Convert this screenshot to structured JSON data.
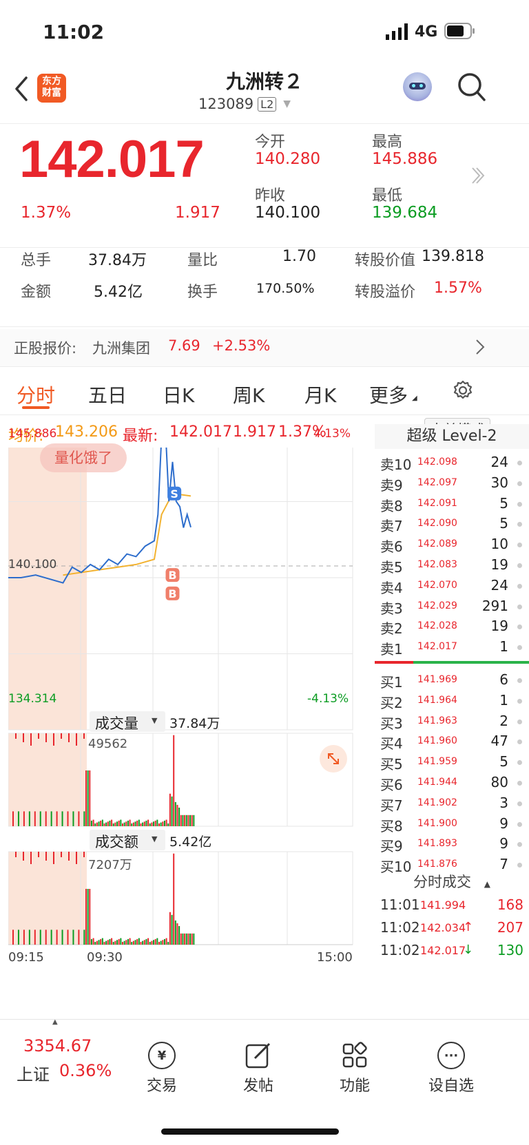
{
  "status": {
    "time": "11:02",
    "network": "4G"
  },
  "header": {
    "title": "九洲转２",
    "code": "123089",
    "level": "L2",
    "logo": "东方\n财富"
  },
  "quote": {
    "price": "142.017",
    "change_pct": "1.37%",
    "change": "1.917",
    "open_label": "今开",
    "open": "140.280",
    "high_label": "最高",
    "high": "145.886",
    "prev_label": "昨收",
    "prev": "140.100",
    "low_label": "最低",
    "low": "139.684"
  },
  "stats": {
    "vol_label": "总手",
    "vol": "37.84万",
    "ratio_label": "量比",
    "ratio": "1.70",
    "conv_label": "转股价值",
    "conv": "139.818",
    "amt_label": "金额",
    "amt": "5.42亿",
    "turn_label": "换手",
    "turn": "170.50%",
    "prem_label": "转股溢价",
    "prem": "1.57%"
  },
  "stock": {
    "label": "正股报价:",
    "name": "九洲集团",
    "price": "7.69",
    "change": "+2.53%"
  },
  "tabs": [
    "分时",
    "五日",
    "日K",
    "周K",
    "月K",
    "更多"
  ],
  "info": {
    "avg_label": "均价:",
    "avg": "143.206",
    "last_label": "最新:",
    "last": "142.017",
    "chg": "1.917",
    "pct": "1.37%",
    "mode_button": "大单模式"
  },
  "chart_data": {
    "type": "line",
    "title": "",
    "y_top": "145.886",
    "y_mid": "140.100",
    "y_bottom": "134.314",
    "pct_top": "4.13%",
    "pct_bottom": "-4.13%",
    "x_labels": [
      "09:15",
      "09:30",
      "15:00"
    ],
    "ylim": [
      134.314,
      145.886
    ],
    "series": [
      {
        "name": "价格",
        "x": [
          0,
          7,
          15,
          30,
          35,
          40,
          45,
          50,
          55,
          60,
          65,
          70,
          75,
          80,
          82,
          84,
          86,
          88,
          90,
          92,
          94,
          96,
          98,
          100
        ],
        "values": [
          140.1,
          140.1,
          140.2,
          139.9,
          140.5,
          140.3,
          140.6,
          140.4,
          140.8,
          140.6,
          141.0,
          140.9,
          141.3,
          141.5,
          142.5,
          145.5,
          145.9,
          143.0,
          144.5,
          143.0,
          142.8,
          142.0,
          142.5,
          142.017
        ]
      },
      {
        "name": "均价",
        "x": [
          30,
          40,
          50,
          60,
          70,
          80,
          84,
          90,
          100
        ],
        "values": [
          140.2,
          140.3,
          140.4,
          140.5,
          140.6,
          140.8,
          142.5,
          143.3,
          143.206
        ]
      }
    ],
    "watermark_badge": "量化饿了",
    "markers": [
      "S",
      "B",
      "B"
    ]
  },
  "volume": {
    "label": "成交量",
    "total": "37.84万",
    "max": "49562"
  },
  "amount": {
    "label": "成交额",
    "total": "5.42亿",
    "max": "7207万"
  },
  "orderbook": {
    "title": "超级 Level-2",
    "asks": [
      {
        "label": "卖10",
        "price": "142.098",
        "qty": "24"
      },
      {
        "label": "卖9",
        "price": "142.097",
        "qty": "30"
      },
      {
        "label": "卖8",
        "price": "142.091",
        "qty": "5"
      },
      {
        "label": "卖7",
        "price": "142.090",
        "qty": "5"
      },
      {
        "label": "卖6",
        "price": "142.089",
        "qty": "10"
      },
      {
        "label": "卖5",
        "price": "142.083",
        "qty": "19"
      },
      {
        "label": "卖4",
        "price": "142.070",
        "qty": "24"
      },
      {
        "label": "卖3",
        "price": "142.029",
        "qty": "291"
      },
      {
        "label": "卖2",
        "price": "142.028",
        "qty": "19"
      },
      {
        "label": "卖1",
        "price": "142.017",
        "qty": "1"
      }
    ],
    "bids": [
      {
        "label": "买1",
        "price": "141.969",
        "qty": "6"
      },
      {
        "label": "买2",
        "price": "141.964",
        "qty": "1"
      },
      {
        "label": "买3",
        "price": "141.963",
        "qty": "2"
      },
      {
        "label": "买4",
        "price": "141.960",
        "qty": "47"
      },
      {
        "label": "买5",
        "price": "141.959",
        "qty": "5"
      },
      {
        "label": "买6",
        "price": "141.944",
        "qty": "80"
      },
      {
        "label": "买7",
        "price": "141.902",
        "qty": "3"
      },
      {
        "label": "买8",
        "price": "141.900",
        "qty": "9"
      },
      {
        "label": "买9",
        "price": "141.893",
        "qty": "9"
      },
      {
        "label": "买10",
        "price": "141.876",
        "qty": "7"
      }
    ],
    "trades_title": "分时成交",
    "trades": [
      {
        "time": "11:01",
        "price": "141.994",
        "arrow": "",
        "qty": "168",
        "dir": "up"
      },
      {
        "time": "11:02",
        "price": "142.034",
        "arrow": "↑",
        "qty": "207",
        "dir": "up"
      },
      {
        "time": "11:02",
        "price": "142.017",
        "arrow": "↓",
        "qty": "130",
        "dir": "down"
      }
    ]
  },
  "bottom": {
    "index_value": "3354.67",
    "index_name": "上证",
    "index_pct": "0.36%",
    "items": [
      "交易",
      "发帖",
      "功能",
      "设自选"
    ]
  }
}
